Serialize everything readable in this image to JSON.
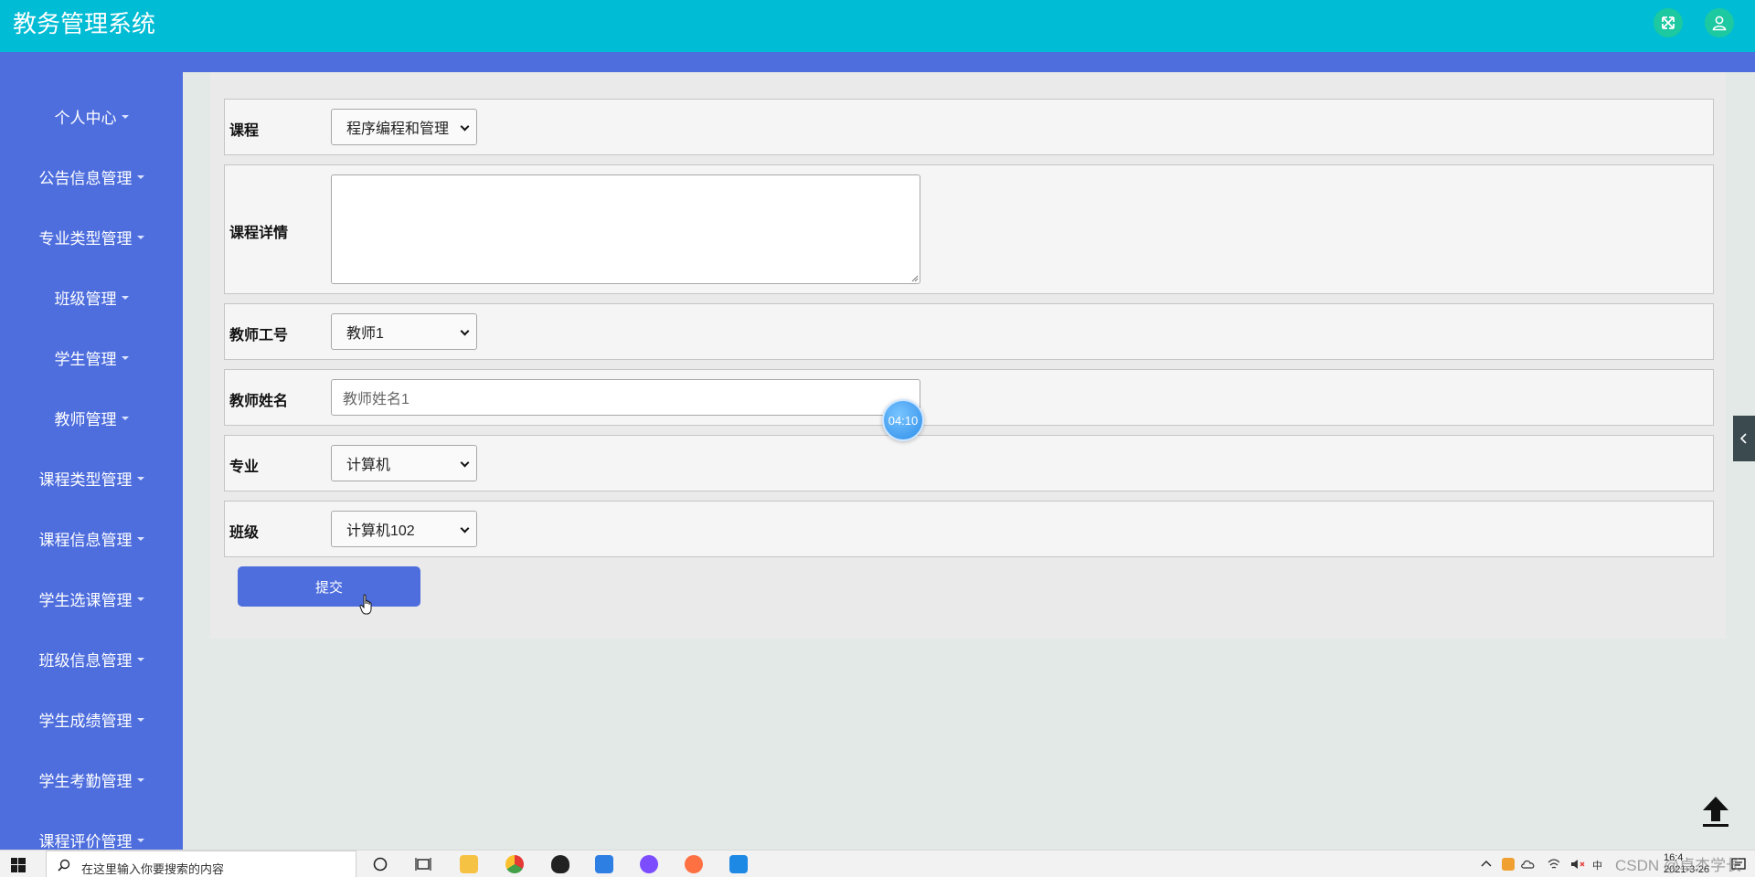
{
  "header": {
    "title": "教务管理系统"
  },
  "sidebar": {
    "items": [
      {
        "label": "个人中心"
      },
      {
        "label": "公告信息管理"
      },
      {
        "label": "专业类型管理"
      },
      {
        "label": "班级管理"
      },
      {
        "label": "学生管理"
      },
      {
        "label": "教师管理"
      },
      {
        "label": "课程类型管理"
      },
      {
        "label": "课程信息管理"
      },
      {
        "label": "学生选课管理"
      },
      {
        "label": "班级信息管理"
      },
      {
        "label": "学生成绩管理"
      },
      {
        "label": "学生考勤管理"
      },
      {
        "label": "课程评价管理"
      }
    ]
  },
  "form": {
    "course": {
      "label": "课程",
      "value": "程序编程和管理"
    },
    "course_detail": {
      "label": "课程详情",
      "value": ""
    },
    "teacher_id": {
      "label": "教师工号",
      "value": "教师1"
    },
    "teacher_name": {
      "label": "教师姓名",
      "value": "教师姓名1"
    },
    "major": {
      "label": "专业",
      "value": "计算机"
    },
    "class": {
      "label": "班级",
      "value": "计算机102"
    },
    "submit_label": "提交"
  },
  "overlay": {
    "timer": "04:10"
  },
  "taskbar": {
    "search_placeholder": "在这里输入你要搜索的内容",
    "tray_ime": "中",
    "watermark": "CSDN @卓杰学长",
    "time": "16:4",
    "date": "2021-3-26"
  }
}
